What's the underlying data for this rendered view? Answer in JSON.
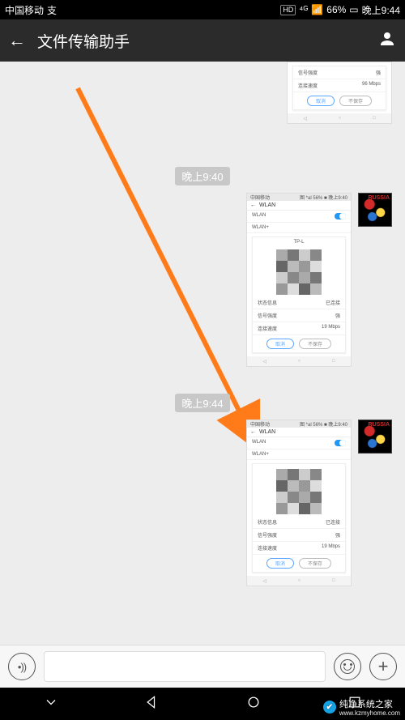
{
  "status_bar": {
    "carrier": "中国移动",
    "hd": "HD",
    "network": "4G",
    "battery_percent": "66%",
    "time": "晚上9:44"
  },
  "header": {
    "title": "文件传输助手"
  },
  "chat": {
    "timestamp1": "晚上9:40",
    "timestamp2": "晚上9:44"
  },
  "thumb": {
    "carrier": "中国移动",
    "status_right": "图 *al 56% ■ 晚上9:40",
    "wlan_title": "WLAN",
    "wlan_label": "WLAN",
    "wlan_plus": "WLAN+",
    "ssid": "TP-L",
    "row1_label": "状态信息",
    "row1_value": "已连接",
    "row2_label": "信号强度",
    "row2_value": "强",
    "row3_label": "连接速度",
    "row3_value": "19 Mbps",
    "row3_value_alt": "96 Mbps",
    "btn_cancel": "取消",
    "btn_disconnect": "不保存"
  },
  "watermark": {
    "title": "纯净系统之家",
    "url": "www.kzmyhome.com"
  }
}
